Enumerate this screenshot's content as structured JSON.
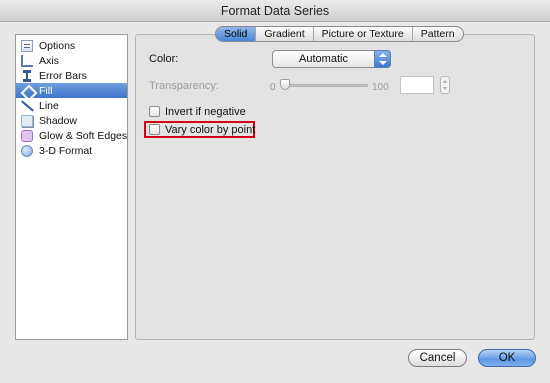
{
  "window": {
    "title": "Format Data Series"
  },
  "sidebar": {
    "items": [
      {
        "label": "Options",
        "icon": "options-icon"
      },
      {
        "label": "Axis",
        "icon": "axis-icon"
      },
      {
        "label": "Error Bars",
        "icon": "error-bars-icon"
      },
      {
        "label": "Fill",
        "icon": "fill-bucket-icon",
        "selected": true
      },
      {
        "label": "Line",
        "icon": "line-icon"
      },
      {
        "label": "Shadow",
        "icon": "shadow-icon"
      },
      {
        "label": "Glow & Soft Edges",
        "icon": "glow-icon"
      },
      {
        "label": "3-D Format",
        "icon": "3d-format-icon"
      }
    ]
  },
  "tabs": [
    {
      "label": "Solid",
      "active": true
    },
    {
      "label": "Gradient"
    },
    {
      "label": "Picture or Texture"
    },
    {
      "label": "Pattern"
    }
  ],
  "fill": {
    "color_label": "Color:",
    "color_value": "Automatic",
    "transparency_label": "Transparency:",
    "transparency_min": "0",
    "transparency_max": "100",
    "transparency_value": "",
    "invert_label": "Invert if negative",
    "vary_label": "Vary color by point"
  },
  "buttons": {
    "cancel": "Cancel",
    "ok": "OK"
  },
  "colors": {
    "accent": "#4d86d6",
    "highlight_border": "#d6001c"
  }
}
